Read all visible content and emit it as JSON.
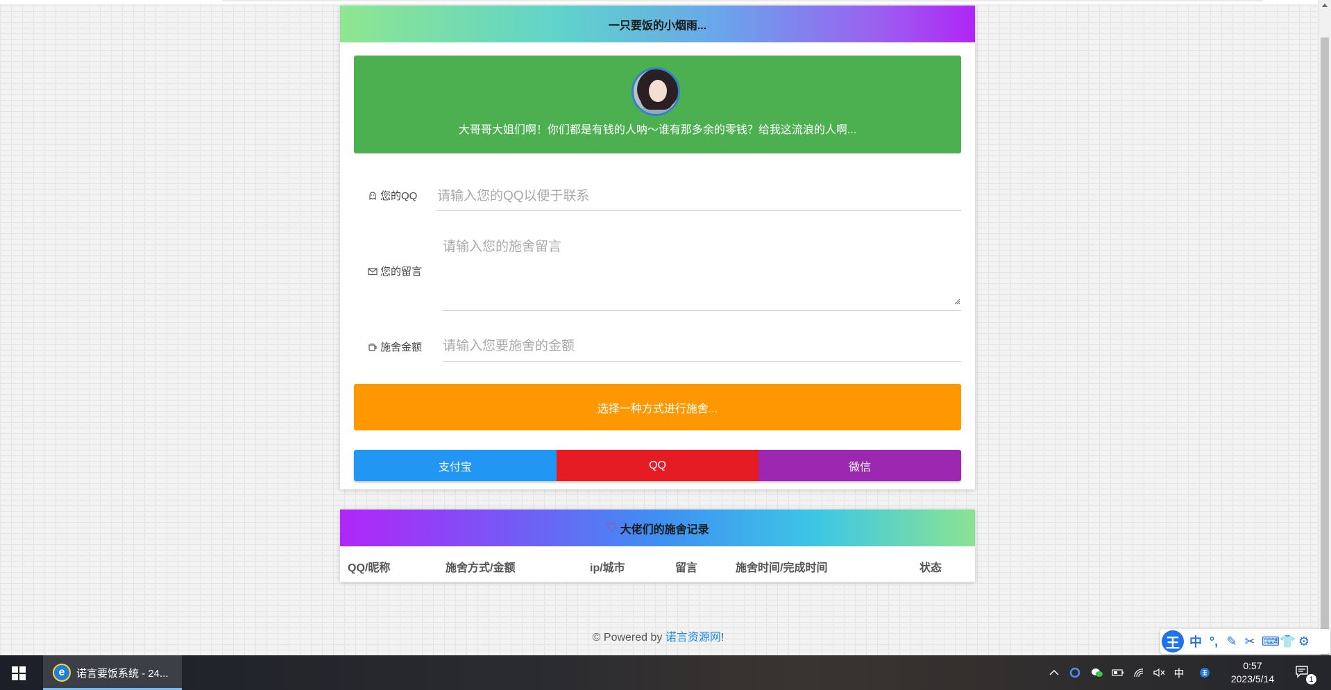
{
  "donate_card": {
    "header_title": "一只要饭的小烟雨...",
    "hero_text": "大哥哥大姐们啊！你们都是有钱的人呐～谁有那多余的零钱？给我这流浪的人啊...",
    "fields": {
      "qq_label": "您的QQ",
      "qq_placeholder": "请输入您的QQ以便于联系",
      "message_label": "您的留言",
      "message_placeholder": "请输入您的施舍留言",
      "amount_label": "施舍金额",
      "amount_placeholder": "请输入您要施舍的金额"
    },
    "give_button": "选择一种方式进行施舍...",
    "payment_methods": [
      {
        "label": "支付宝",
        "color": "#2196f3"
      },
      {
        "label": "QQ",
        "color": "#e51c23"
      },
      {
        "label": "微信",
        "color": "#9c27b0"
      }
    ]
  },
  "records_card": {
    "header_title": "大佬们的施舍记录",
    "columns": [
      "QQ/昵称",
      "施舍方式/金额",
      "ip/城市",
      "留言",
      "施舍时间/完成时间",
      "状态"
    ]
  },
  "footer": {
    "prefix": "© Powered by ",
    "link": "诺言资源网",
    "suffix": "!"
  },
  "ime_toolbar": {
    "logo": "王",
    "mode": "中",
    "items": [
      "punctuation-icon",
      "pen-icon",
      "scissors-icon",
      "keyboard-icon",
      "skin-icon",
      "settings-icon"
    ]
  },
  "taskbar": {
    "active_window": "诺言要饭系统 - 24...",
    "tray_lang": "中",
    "time": "0:57",
    "date": "2023/5/14",
    "notification_count": "1"
  },
  "colors": {
    "hero_green": "#4caf50",
    "give_orange": "#ff9800",
    "link_blue": "#1e88e5"
  }
}
